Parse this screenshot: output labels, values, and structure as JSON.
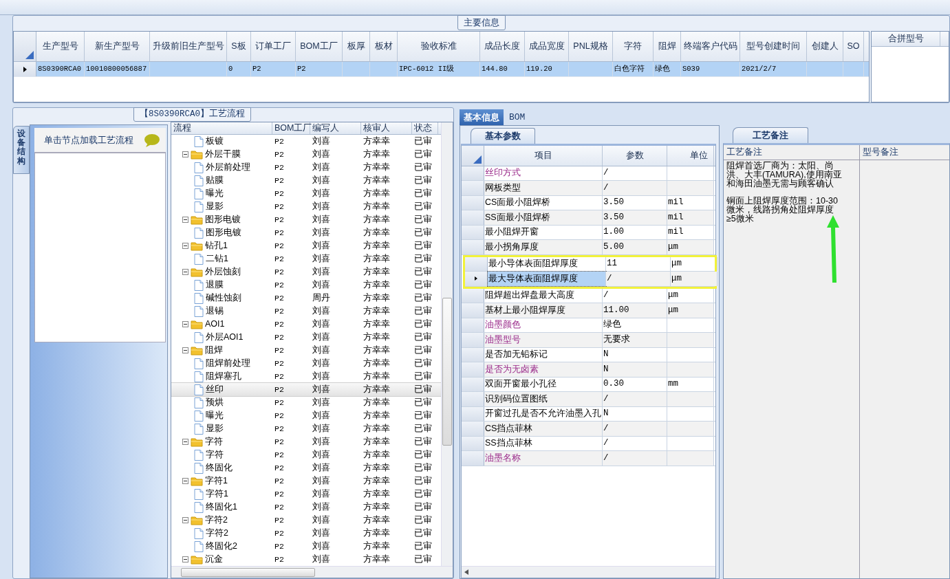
{
  "main_info": {
    "title": "主要信息",
    "table": {
      "columns": [
        "生产型号",
        "新生产型号",
        "升级前旧生产型号",
        "S板",
        "订单工厂",
        "BOM工厂",
        "板厚",
        "板材",
        "验收标准",
        "成品长度",
        "成品宽度",
        "PNL规格",
        "字符",
        "阻焊",
        "终端客户代码",
        "型号创建时间",
        "创建人",
        "SO"
      ],
      "rows": [
        {
          "selected": true,
          "cells": [
            "8S0390RCA0",
            "10010800056887",
            null,
            "0",
            "P2",
            "P2",
            null,
            null,
            "IPC-6012 II级",
            "144.80",
            "119.20",
            null,
            "白色字符",
            "绿色",
            "S039",
            "2021/2/7",
            null,
            null
          ]
        }
      ]
    },
    "merge_panel": {
      "columns": [
        "合拼型号"
      ]
    }
  },
  "process_flow": {
    "title": "【8S0390RCA0】工艺流程",
    "side_tab": "设备结构",
    "side_header": "单击节点加载工艺流程",
    "columns": [
      "流程",
      "BOM工厂",
      "编写人",
      "核审人",
      "状态"
    ],
    "rows": [
      {
        "label": "板镀",
        "kind": "leaf",
        "selected": false,
        "bom": "P2",
        "writer": "刘喜",
        "reviewer": "方幸幸",
        "status": "已审"
      },
      {
        "label": "外层干膜",
        "kind": "folder",
        "expanded": true,
        "selected": false,
        "bom": "P2",
        "writer": "刘喜",
        "reviewer": "方幸幸",
        "status": "已审",
        "children": [
          {
            "label": "外层前处理",
            "kind": "leaf",
            "selected": false,
            "bom": "P2",
            "writer": "刘喜",
            "reviewer": "方幸幸",
            "status": "已审"
          },
          {
            "label": "贴膜",
            "kind": "leaf",
            "selected": false,
            "bom": "P2",
            "writer": "刘喜",
            "reviewer": "方幸幸",
            "status": "已审"
          },
          {
            "label": "曝光",
            "kind": "leaf",
            "selected": false,
            "bom": "P2",
            "writer": "刘喜",
            "reviewer": "方幸幸",
            "status": "已审"
          },
          {
            "label": "显影",
            "kind": "leaf",
            "selected": false,
            "bom": "P2",
            "writer": "刘喜",
            "reviewer": "方幸幸",
            "status": "已审"
          }
        ]
      },
      {
        "label": "图形电镀",
        "kind": "folder",
        "expanded": true,
        "selected": false,
        "bom": "P2",
        "writer": "刘喜",
        "reviewer": "方幸幸",
        "status": "已审",
        "children": [
          {
            "label": "图形电镀",
            "kind": "leaf",
            "selected": false,
            "bom": "P2",
            "writer": "刘喜",
            "reviewer": "方幸幸",
            "status": "已审"
          }
        ]
      },
      {
        "label": "钻孔1",
        "kind": "folder",
        "expanded": true,
        "selected": false,
        "bom": "P2",
        "writer": "刘喜",
        "reviewer": "方幸幸",
        "status": "已审",
        "children": [
          {
            "label": "二钻1",
            "kind": "leaf",
            "selected": false,
            "bom": "P2",
            "writer": "刘喜",
            "reviewer": "方幸幸",
            "status": "已审"
          }
        ]
      },
      {
        "label": "外层蚀刻",
        "kind": "folder",
        "expanded": true,
        "selected": false,
        "bom": "P2",
        "writer": "刘喜",
        "reviewer": "方幸幸",
        "status": "已审",
        "children": [
          {
            "label": "退膜",
            "kind": "leaf",
            "selected": false,
            "bom": "P2",
            "writer": "刘喜",
            "reviewer": "方幸幸",
            "status": "已审"
          },
          {
            "label": "碱性蚀刻",
            "kind": "leaf",
            "selected": false,
            "bom": "P2",
            "writer": "周丹",
            "reviewer": "方幸幸",
            "status": "已审"
          },
          {
            "label": "退锡",
            "kind": "leaf",
            "selected": false,
            "bom": "P2",
            "writer": "刘喜",
            "reviewer": "方幸幸",
            "status": "已审"
          }
        ]
      },
      {
        "label": "AOI1",
        "kind": "folder",
        "expanded": true,
        "selected": false,
        "bom": "P2",
        "writer": "刘喜",
        "reviewer": "方幸幸",
        "status": "已审",
        "children": [
          {
            "label": "外层AOI1",
            "kind": "leaf",
            "selected": false,
            "bom": "P2",
            "writer": "刘喜",
            "reviewer": "方幸幸",
            "status": "已审"
          }
        ]
      },
      {
        "label": "阻焊",
        "kind": "folder",
        "expanded": true,
        "selected": false,
        "bom": "P2",
        "writer": "刘喜",
        "reviewer": "方幸幸",
        "status": "已审",
        "children": [
          {
            "label": "阻焊前处理",
            "kind": "leaf",
            "selected": false,
            "bom": "P2",
            "writer": "刘喜",
            "reviewer": "方幸幸",
            "status": "已审"
          },
          {
            "label": "阻焊塞孔",
            "kind": "leaf",
            "selected": false,
            "bom": "P2",
            "writer": "刘喜",
            "reviewer": "方幸幸",
            "status": "已审"
          },
          {
            "label": "丝印",
            "kind": "leaf",
            "selected": true,
            "bom": "P2",
            "writer": "刘喜",
            "reviewer": "方幸幸",
            "status": "已审"
          },
          {
            "label": "预烘",
            "kind": "leaf",
            "selected": false,
            "bom": "P2",
            "writer": "刘喜",
            "reviewer": "方幸幸",
            "status": "已审"
          },
          {
            "label": "曝光",
            "kind": "leaf",
            "selected": false,
            "bom": "P2",
            "writer": "刘喜",
            "reviewer": "方幸幸",
            "status": "已审"
          },
          {
            "label": "显影",
            "kind": "leaf",
            "selected": false,
            "bom": "P2",
            "writer": "刘喜",
            "reviewer": "方幸幸",
            "status": "已审"
          }
        ]
      },
      {
        "label": "字符",
        "kind": "folder",
        "expanded": true,
        "selected": false,
        "bom": "P2",
        "writer": "刘喜",
        "reviewer": "方幸幸",
        "status": "已审",
        "children": [
          {
            "label": "字符",
            "kind": "leaf",
            "selected": false,
            "bom": "P2",
            "writer": "刘喜",
            "reviewer": "方幸幸",
            "status": "已审"
          },
          {
            "label": "终固化",
            "kind": "leaf",
            "selected": false,
            "bom": "P2",
            "writer": "刘喜",
            "reviewer": "方幸幸",
            "status": "已审"
          }
        ]
      },
      {
        "label": "字符1",
        "kind": "folder",
        "expanded": true,
        "selected": false,
        "bom": "P2",
        "writer": "刘喜",
        "reviewer": "方幸幸",
        "status": "已审",
        "children": [
          {
            "label": "字符1",
            "kind": "leaf",
            "selected": false,
            "bom": "P2",
            "writer": "刘喜",
            "reviewer": "方幸幸",
            "status": "已审"
          },
          {
            "label": "终固化1",
            "kind": "leaf",
            "selected": false,
            "bom": "P2",
            "writer": "刘喜",
            "reviewer": "方幸幸",
            "status": "已审"
          }
        ]
      },
      {
        "label": "字符2",
        "kind": "folder",
        "expanded": true,
        "selected": false,
        "bom": "P2",
        "writer": "刘喜",
        "reviewer": "方幸幸",
        "status": "已审",
        "children": [
          {
            "label": "字符2",
            "kind": "leaf",
            "selected": false,
            "bom": "P2",
            "writer": "刘喜",
            "reviewer": "方幸幸",
            "status": "已审"
          },
          {
            "label": "终固化2",
            "kind": "leaf",
            "selected": false,
            "bom": "P2",
            "writer": "刘喜",
            "reviewer": "方幸幸",
            "status": "已审"
          }
        ]
      },
      {
        "label": "沉金",
        "kind": "folder",
        "expanded": true,
        "selected": false,
        "bom": "P2",
        "writer": "刘喜",
        "reviewer": "方幸幸",
        "status": "已审"
      }
    ]
  },
  "details": {
    "tabs": [
      {
        "label": "基本信息",
        "selected": true
      },
      {
        "label": "BOM",
        "selected": false
      }
    ],
    "sub_tab": "基本参数",
    "columns": [
      "项目",
      "参数",
      "单位"
    ],
    "rows": [
      {
        "item": "丝印方式",
        "value": "/",
        "emphasis": true,
        "selected": false,
        "highlighted": false
      },
      {
        "item": "网板类型",
        "value": "/",
        "emphasis": false,
        "selected": false,
        "highlighted": false
      },
      {
        "item": "CS面最小阻焊桥",
        "value": "3.50",
        "unit": "mil",
        "emphasis": false,
        "selected": false,
        "highlighted": false
      },
      {
        "item": "SS面最小阻焊桥",
        "value": "3.50",
        "unit": "mil",
        "emphasis": false,
        "selected": false,
        "highlighted": false
      },
      {
        "item": "最小阻焊开窗",
        "value": "1.00",
        "unit": "mil",
        "emphasis": false,
        "selected": false,
        "highlighted": false
      },
      {
        "item": "最小拐角厚度",
        "value": "5.00",
        "unit": "μm",
        "emphasis": false,
        "selected": false,
        "highlighted": false
      },
      {
        "item": "最小导体表面阻焊厚度",
        "value": "11",
        "unit": "μm",
        "emphasis": false,
        "selected": false,
        "highlighted": true
      },
      {
        "item": "最大导体表面阻焊厚度",
        "value": "/",
        "unit": "μm",
        "emphasis": false,
        "selected": true,
        "highlighted": true
      },
      {
        "item": "阻焊超出焊盘最大高度",
        "value": "/",
        "unit": "μm",
        "emphasis": false,
        "selected": false,
        "highlighted": false
      },
      {
        "item": "基材上最小阻焊厚度",
        "value": "11.00",
        "unit": "μm",
        "emphasis": false,
        "selected": false,
        "highlighted": false
      },
      {
        "item": "油墨颜色",
        "value": "绿色",
        "emphasis": true,
        "selected": false,
        "highlighted": false
      },
      {
        "item": "油墨型号",
        "value": "无要求",
        "emphasis": true,
        "selected": false,
        "highlighted": false
      },
      {
        "item": "是否加无铅标记",
        "value": "N",
        "emphasis": false,
        "selected": false,
        "highlighted": false
      },
      {
        "item": "是否为无卤素",
        "value": "N",
        "emphasis": true,
        "selected": false,
        "highlighted": false
      },
      {
        "item": "双面开窗最小孔径",
        "value": "0.30",
        "unit": "mm",
        "emphasis": false,
        "selected": false,
        "highlighted": false
      },
      {
        "item": "识别码位置图纸",
        "value": "/",
        "emphasis": false,
        "selected": false,
        "highlighted": false
      },
      {
        "item": "开窗过孔是否不允许油墨入孔",
        "value": "N",
        "emphasis": false,
        "selected": false,
        "highlighted": false
      },
      {
        "item": "CS挡点菲林",
        "value": "/",
        "emphasis": false,
        "selected": false,
        "highlighted": false
      },
      {
        "item": "SS挡点菲林",
        "value": "/",
        "emphasis": false,
        "selected": false,
        "highlighted": false
      },
      {
        "item": "油墨名称",
        "value": "/",
        "emphasis": true,
        "selected": false,
        "highlighted": false
      }
    ]
  },
  "notes": {
    "tab": "工艺备注",
    "columns": [
      "工艺备注",
      "型号备注"
    ],
    "process_note": [
      "阻焊首选厂商为：太阳、尚洪、大丰(TAMURA),使用南亚和海田油墨无需与顾客确认",
      "铜面上阻焊厚度范围：10-30微米，线路拐角处阻焊厚度≥5微米"
    ],
    "annotations": [
      {
        "kind": "arrow"
      }
    ]
  }
}
